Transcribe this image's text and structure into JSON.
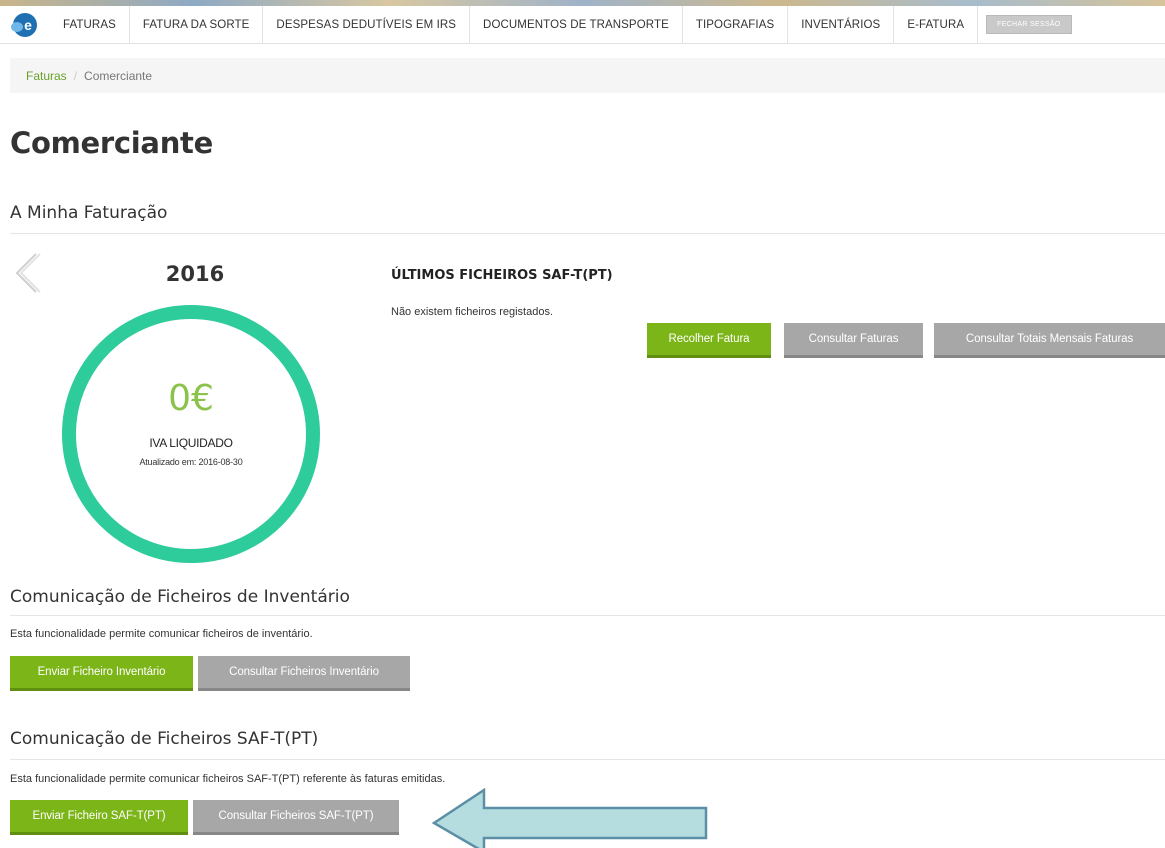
{
  "navbar": {
    "logo_letter": "e",
    "items": [
      "FATURAS",
      "FATURA DA SORTE",
      "DESPESAS DEDUTÍVEIS EM IRS",
      "DOCUMENTOS DE TRANSPORTE",
      "TIPOGRAFIAS",
      "INVENTÁRIOS",
      "E-FATURA"
    ],
    "logout_label": "FECHAR SESSÃO"
  },
  "breadcrumb": {
    "link": "Faturas",
    "separator": "/",
    "current": "Comerciante"
  },
  "page_title": "Comerciante",
  "billing": {
    "section_title": "A Minha Faturação",
    "year": "2016",
    "amount": "0€",
    "amount_label": "IVA LIQUIDADO",
    "updated": "Atualizado em: 2016-08-30",
    "saft_title": "ÚLTIMOS FICHEIROS SAF-T(PT)",
    "saft_empty": "Não existem ficheiros registados.",
    "buttons": {
      "collect": "Recolher Fatura",
      "consult": "Consultar Faturas",
      "monthly": "Consultar Totais Mensais Faturas"
    }
  },
  "inventory": {
    "section_title": "Comunicação de Ficheiros de Inventário",
    "description": "Esta funcionalidade permite comunicar ficheiros de inventário.",
    "send_label": "Enviar Ficheiro Inventário",
    "consult_label": "Consultar Ficheiros Inventário"
  },
  "saft": {
    "section_title": "Comunicação de Ficheiros SAF-T(PT)",
    "description": "Esta funcionalidade permite comunicar ficheiros SAF-T(PT) referente às faturas emitidas.",
    "send_label": "Enviar Ficheiro SAF-T(PT)",
    "consult_label": "Consultar Ficheiros SAF-T(PT)"
  },
  "colors": {
    "accent_green": "#7cb518",
    "ring_teal": "#2ecb9b",
    "button_grey": "#a7a7a7",
    "arrow_fill": "#b5dde0",
    "link_green": "#6aa12a"
  }
}
